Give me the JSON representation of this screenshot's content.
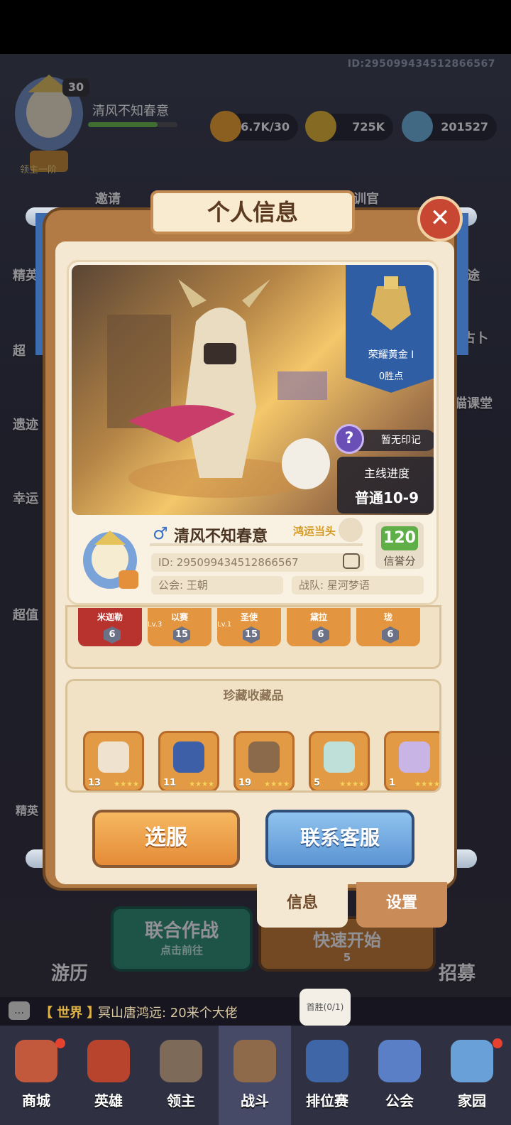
{
  "header": {
    "player_id": "ID:2950994345128665​67",
    "lord_level": "30",
    "lord_name": "清风不知春意",
    "lord_rank_title": "领主一阶",
    "xp_progress": 0.78,
    "resources": [
      {
        "icon": "stamina-flame-icon",
        "value": "6.7K/30",
        "color": "#f2a52b"
      },
      {
        "icon": "gold-coin-icon",
        "value": "725K",
        "color": "#e8b830"
      },
      {
        "icon": "crystal-star-icon",
        "value": "201527",
        "color": "#6fb6e0"
      }
    ]
  },
  "background_menu": {
    "left_items": [
      "精英",
      "超",
      "遗迹",
      "幸运",
      "超值"
    ],
    "top_items": [
      "邀请",
      "训官"
    ],
    "right_items": [
      "通途",
      "占卜",
      "猫课堂"
    ],
    "combat_button": "联合作战",
    "combat_sub": "点击前往",
    "quick_start": "快速开始",
    "quick_start_cost": "5",
    "travel": "游历",
    "recruit": "招募",
    "elite_tag": "精英"
  },
  "chat": {
    "channel": "【 世界 】",
    "message": "冥山唐鸿远: 20来个大佬"
  },
  "first_win": "首胜(0/1)",
  "nav": [
    {
      "label": "商城",
      "icon": "shop-chest-icon",
      "dot": true
    },
    {
      "label": "英雄",
      "icon": "hero-card-icon",
      "dot": false
    },
    {
      "label": "领主",
      "icon": "lord-banner-icon",
      "dot": false
    },
    {
      "label": "战斗",
      "icon": "battle-swords-icon",
      "dot": false
    },
    {
      "label": "排位赛",
      "icon": "ranked-shield-icon",
      "dot": false
    },
    {
      "label": "公会",
      "icon": "guild-castle-icon",
      "dot": false
    },
    {
      "label": "家园",
      "icon": "home-house-icon",
      "dot": true
    }
  ],
  "modal": {
    "title": "个人信息",
    "rank": {
      "name": "荣耀黄金 I",
      "points": "0胜点"
    },
    "mark": "暂无印记",
    "progress_title": "主线进度",
    "progress_value": "普通10-9",
    "gender": "♂",
    "player_name": "清风不知春意",
    "title_tag": "鸿运当头",
    "id_row": "ID: 2950994345128665​67",
    "guild_row": "公会: 王朝",
    "team_row": "战队: 星河梦语",
    "credit_value": "120",
    "credit_label": "信誉分",
    "heroes": [
      {
        "name": "米迦勒",
        "level": "6",
        "lv": "",
        "color": "#b8322e"
      },
      {
        "name": "以赛",
        "level": "15",
        "lv": "Lv.3",
        "color": "#e3953f"
      },
      {
        "name": "圣使",
        "level": "15",
        "lv": "Lv.1",
        "color": "#e3953f"
      },
      {
        "name": "黛拉",
        "level": "6",
        "lv": "",
        "color": "#e3953f"
      },
      {
        "name": "珑",
        "level": "6",
        "lv": "",
        "color": "#e3953f"
      }
    ],
    "collection_title": "珍藏收藏品",
    "collection": [
      {
        "icon": "scroll-document-icon",
        "count": "13",
        "stars": "★★★★"
      },
      {
        "icon": "blue-bird-egg-icon",
        "count": "11",
        "stars": "★★★★"
      },
      {
        "icon": "golden-hammer-icon",
        "count": "19",
        "stars": "★★★★"
      },
      {
        "icon": "feather-quill-icon",
        "count": "5",
        "stars": "★★★★"
      },
      {
        "icon": "fairy-wings-icon",
        "count": "1",
        "stars": "★★★★"
      }
    ],
    "btn_server": "选服",
    "btn_service": "联系客服",
    "tabs": [
      {
        "label": "信息",
        "active": true
      },
      {
        "label": "设置",
        "active": false
      }
    ],
    "close_icon": "close-x-icon"
  }
}
